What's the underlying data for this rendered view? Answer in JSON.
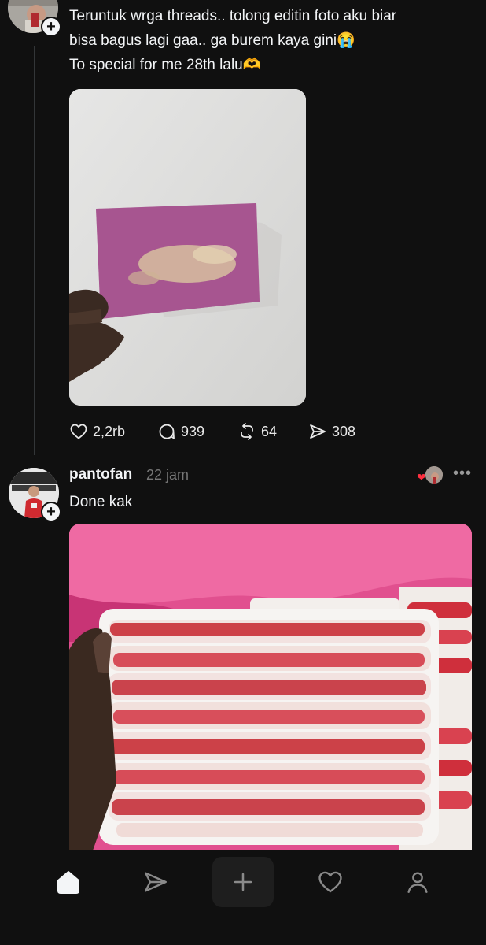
{
  "post1": {
    "text_line1": "Teruntuk wrga threads.. tolong editin foto aku biar",
    "text_line2": "bisa bagus lagi gaa.. ga burem kaya gini😭",
    "text_line3": "To special for me 28th lalu🫶",
    "actions": {
      "likes": "2,2rb",
      "comments": "939",
      "reposts": "64",
      "shares": "308"
    }
  },
  "post2": {
    "username": "pantofan",
    "time": "22 jam",
    "text": "Done kak"
  },
  "bottom_nav": [
    "home-icon",
    "send-icon",
    "create-icon",
    "heart-icon",
    "profile-icon"
  ],
  "colors": {
    "background": "#101010",
    "text": "#f3f5f7",
    "muted": "#777777",
    "like_red": "#ff3040"
  }
}
